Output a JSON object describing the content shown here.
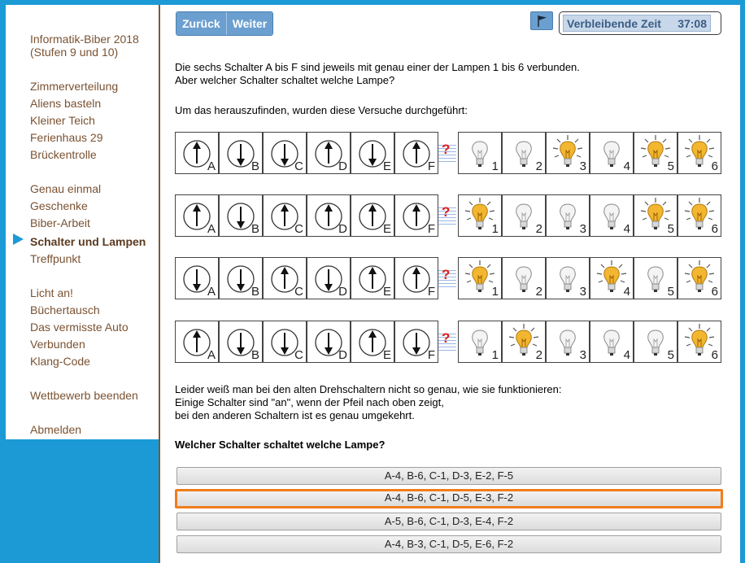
{
  "sidebar": {
    "title_line1": "Informatik-Biber 2018",
    "title_line2": "(Stufen 9 und 10)",
    "items": [
      {
        "label": "Zimmerverteilung"
      },
      {
        "label": "Aliens basteln"
      },
      {
        "label": "Kleiner Teich"
      },
      {
        "label": "Ferienhaus 29"
      },
      {
        "label": "Brückentrolle"
      },
      {
        "label": "Genau einmal"
      },
      {
        "label": "Geschenke"
      },
      {
        "label": "Biber-Arbeit"
      },
      {
        "label": "Schalter und Lampen"
      },
      {
        "label": "Treffpunkt"
      },
      {
        "label": "Licht an!"
      },
      {
        "label": "Büchertausch"
      },
      {
        "label": "Das vermisste Auto"
      },
      {
        "label": "Verbunden"
      },
      {
        "label": "Klang-Code"
      },
      {
        "label": "Wettbewerb beenden"
      },
      {
        "label": "Abmelden"
      }
    ],
    "active_item": "Schalter und Lampen",
    "accent": "#1b9ad6"
  },
  "nav": {
    "back_label": "Zurück",
    "next_label": "Weiter",
    "flag_icon": "flag-icon"
  },
  "timer": {
    "label": "Verbleibende Zeit",
    "value": "37:08"
  },
  "task": {
    "intro_line1": "Die sechs Schalter A bis F sind jeweils mit genau einer der Lampen 1 bis 6 verbunden.",
    "intro_line2": "Aber welcher Schalter schaltet welche Lampe?",
    "experiments_intro": "Um das herauszufinden, wurden diese Versuche durchgeführt:",
    "note_line1": "Leider weiß man bei den alten Drehschaltern nicht so genau, wie sie funktionieren:",
    "note_line2": "Einige Schalter sind \"an\", wenn der Pfeil nach oben zeigt,",
    "note_line3": "bei den anderen Schaltern ist es genau umgekehrt.",
    "question": "Welcher Schalter schaltet welche Lampe?",
    "question_mark": "?"
  },
  "switch_letters": [
    "A",
    "B",
    "C",
    "D",
    "E",
    "F"
  ],
  "lamp_numbers": [
    "1",
    "2",
    "3",
    "4",
    "5",
    "6"
  ],
  "experiments": [
    {
      "switches": [
        "up",
        "down",
        "down",
        "up",
        "down",
        "up"
      ],
      "lamps": [
        "off",
        "off",
        "on",
        "off",
        "on",
        "on"
      ]
    },
    {
      "switches": [
        "up",
        "down",
        "up",
        "up",
        "up",
        "up"
      ],
      "lamps": [
        "on",
        "off",
        "off",
        "off",
        "on",
        "on"
      ]
    },
    {
      "switches": [
        "down",
        "down",
        "up",
        "down",
        "up",
        "up"
      ],
      "lamps": [
        "on",
        "off",
        "off",
        "on",
        "off",
        "on"
      ]
    },
    {
      "switches": [
        "up",
        "down",
        "down",
        "down",
        "up",
        "down"
      ],
      "lamps": [
        "off",
        "on",
        "off",
        "off",
        "off",
        "on"
      ]
    }
  ],
  "answers": [
    {
      "label": "A-4, B-6, C-1, D-3, E-2, F-5",
      "selected": false
    },
    {
      "label": "A-4, B-6, C-1, D-5, E-3, F-2",
      "selected": true
    },
    {
      "label": "A-5, B-6, C-1, D-3, E-4, F-2",
      "selected": false
    },
    {
      "label": "A-4, B-3, C-1, D-5, E-6, F-2",
      "selected": false
    }
  ],
  "colors": {
    "selected_border": "#f07d1c",
    "lamp_on": "#f2b630",
    "question_mark": "#e0201c"
  }
}
